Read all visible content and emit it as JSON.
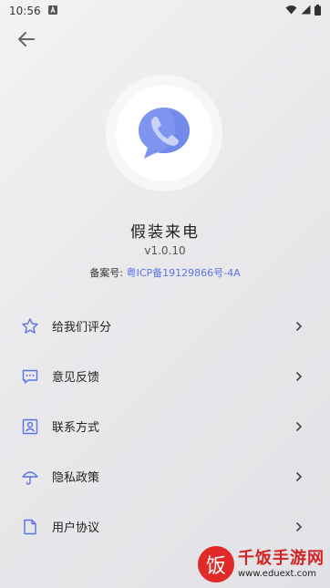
{
  "status_bar": {
    "time": "10:56",
    "notification_icon": "a-icon",
    "icons": [
      "wifi-icon",
      "signal-icon",
      "battery-icon"
    ]
  },
  "header": {
    "back_icon": "arrow-left-icon"
  },
  "app": {
    "name": "假装来电",
    "version": "v1.0.10",
    "icp_label": "备案号: ",
    "icp_number": "粤ICP备19129866号-4A",
    "logo_icon": "phone-chat-icon"
  },
  "menu": [
    {
      "label": "给我们评分",
      "icon": "star-icon"
    },
    {
      "label": "意见反馈",
      "icon": "feedback-icon"
    },
    {
      "label": "联系方式",
      "icon": "contact-card-icon"
    },
    {
      "label": "隐私政策",
      "icon": "umbrella-icon"
    },
    {
      "label": "用户协议",
      "icon": "document-icon"
    }
  ],
  "watermark": {
    "logo_char": "饭",
    "name": "千饭手游网",
    "url": "www.eduext.com"
  },
  "colors": {
    "accent": "#5b72e6",
    "logo_blue": "#7d95ee",
    "logo_light": "#c9d3f8"
  }
}
